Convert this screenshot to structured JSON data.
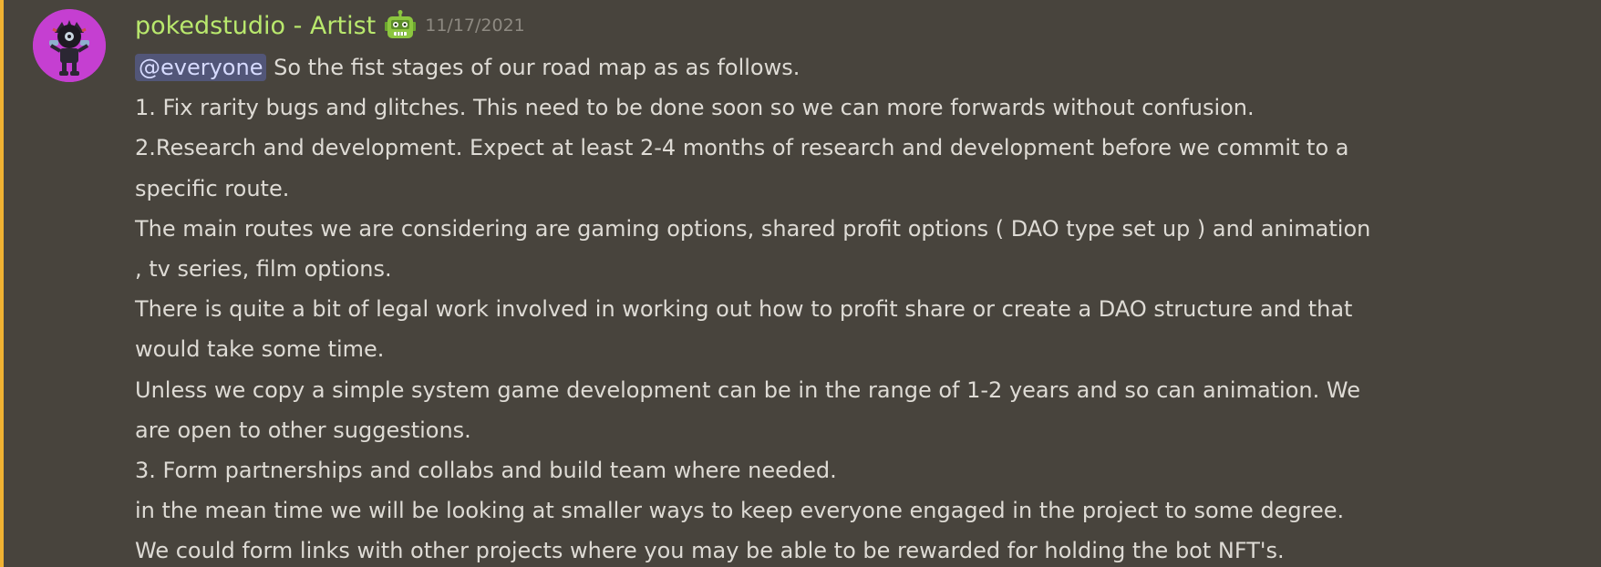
{
  "message": {
    "author": "pokedstudio - Artist",
    "timestamp": "11/17/2021",
    "author_color": "#b9e86d",
    "highlight_color": "#f0b232",
    "mention": "@everyone",
    "first_line_rest": " So the fist stages of our road map as as follows.",
    "lines": [
      "1. Fix rarity bugs and glitches. This need to be done soon so we can more forwards without confusion.",
      "2.Research and development. Expect at least 2-4 months of research and development before we commit to a",
      "specific route.",
      "The main routes we are considering are gaming options, shared profit options ( DAO type set up ) and animation",
      ", tv series, film options.",
      "There is quite a bit of legal work involved in working out how to profit share or create a DAO structure and that",
      "would take some time.",
      "Unless we copy a simple system game development can be in the range of 1-2 years and so can animation. We",
      "are open to other suggestions.",
      "3. Form partnerships and collabs and build team where needed.",
      "in the mean time we will be looking at smaller ways to keep everyone engaged in the project to some degree.",
      "We could form links with other projects where you may be able to be rewarded for holding the bot NFT's."
    ]
  }
}
